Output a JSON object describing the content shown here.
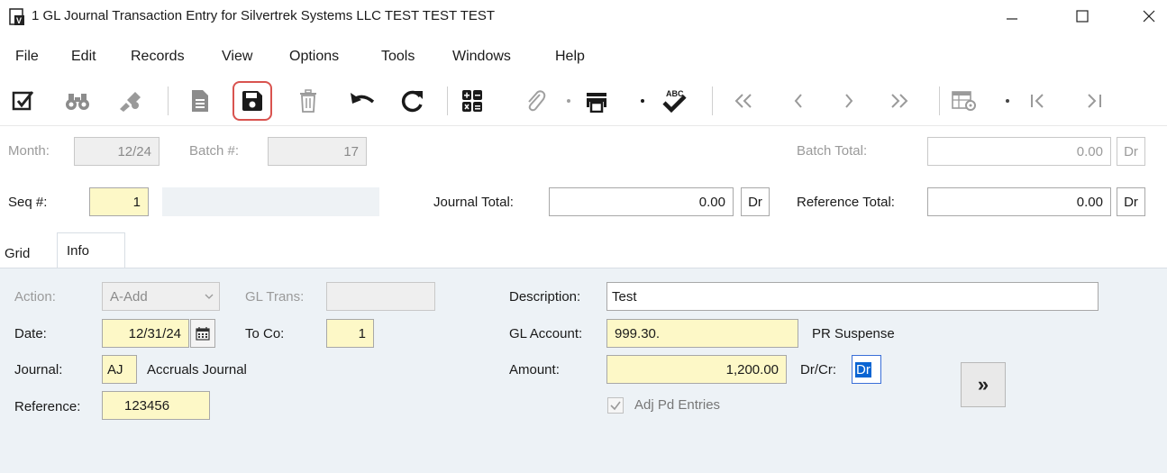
{
  "window": {
    "title": "1 GL Journal Transaction Entry for Silvertrek Systems LLC TEST TEST TEST"
  },
  "menu": [
    "File",
    "Edit",
    "Records",
    "View",
    "Options",
    "Tools",
    "Windows",
    "Help"
  ],
  "toolbar": {
    "icons": [
      "checklist-icon",
      "binoculars-icon",
      "stamp-icon",
      "document-icon",
      "save-icon",
      "trash-icon",
      "undo-icon",
      "refresh-icon",
      "calculator-icon",
      "attachment-icon",
      "print-icon",
      "spellcheck-icon",
      "first-icon",
      "previous-icon",
      "next-icon",
      "last-icon",
      "grid-settings-icon",
      "collapse-icon",
      "expand-icon"
    ],
    "highlight_color": "#d9534f",
    "spellcheck_label": "ABC"
  },
  "header": {
    "month_label": "Month:",
    "month_value": "12/24",
    "batch_label": "Batch #:",
    "batch_value": "17",
    "batch_total_label": "Batch Total:",
    "batch_total_value": "0.00",
    "batch_total_drcr": "Dr",
    "seq_label": "Seq #:",
    "seq_value": "1",
    "journal_total_label": "Journal Total:",
    "journal_total_value": "0.00",
    "journal_total_drcr": "Dr",
    "reference_total_label": "Reference Total:",
    "reference_total_value": "0.00",
    "reference_total_drcr": "Dr"
  },
  "tabs": [
    "Grid",
    "Info"
  ],
  "info": {
    "action_label": "Action:",
    "action_value": "A-Add",
    "gl_trans_label": "GL Trans:",
    "gl_trans_value": "",
    "date_label": "Date:",
    "date_value": "12/31/24",
    "to_co_label": "To Co:",
    "to_co_value": "1",
    "journal_label": "Journal:",
    "journal_code": "AJ",
    "journal_name": "Accruals Journal",
    "reference_label": "Reference:",
    "reference_value": "123456",
    "description_label": "Description:",
    "description_value": "Test",
    "gl_account_label": "GL Account:",
    "gl_account_value": "999.30.",
    "gl_account_name": "PR Suspense",
    "amount_label": "Amount:",
    "amount_value": "1,200.00",
    "drcr_label": "Dr/Cr:",
    "drcr_value": "Dr",
    "adj_pd_label": "Adj Pd Entries",
    "adj_pd_checked": true,
    "more_button": "»"
  },
  "colors": {
    "field_yellow": "#fdf8c7",
    "panel_bg": "#edf2f6",
    "selection_blue": "#0a64d2"
  }
}
